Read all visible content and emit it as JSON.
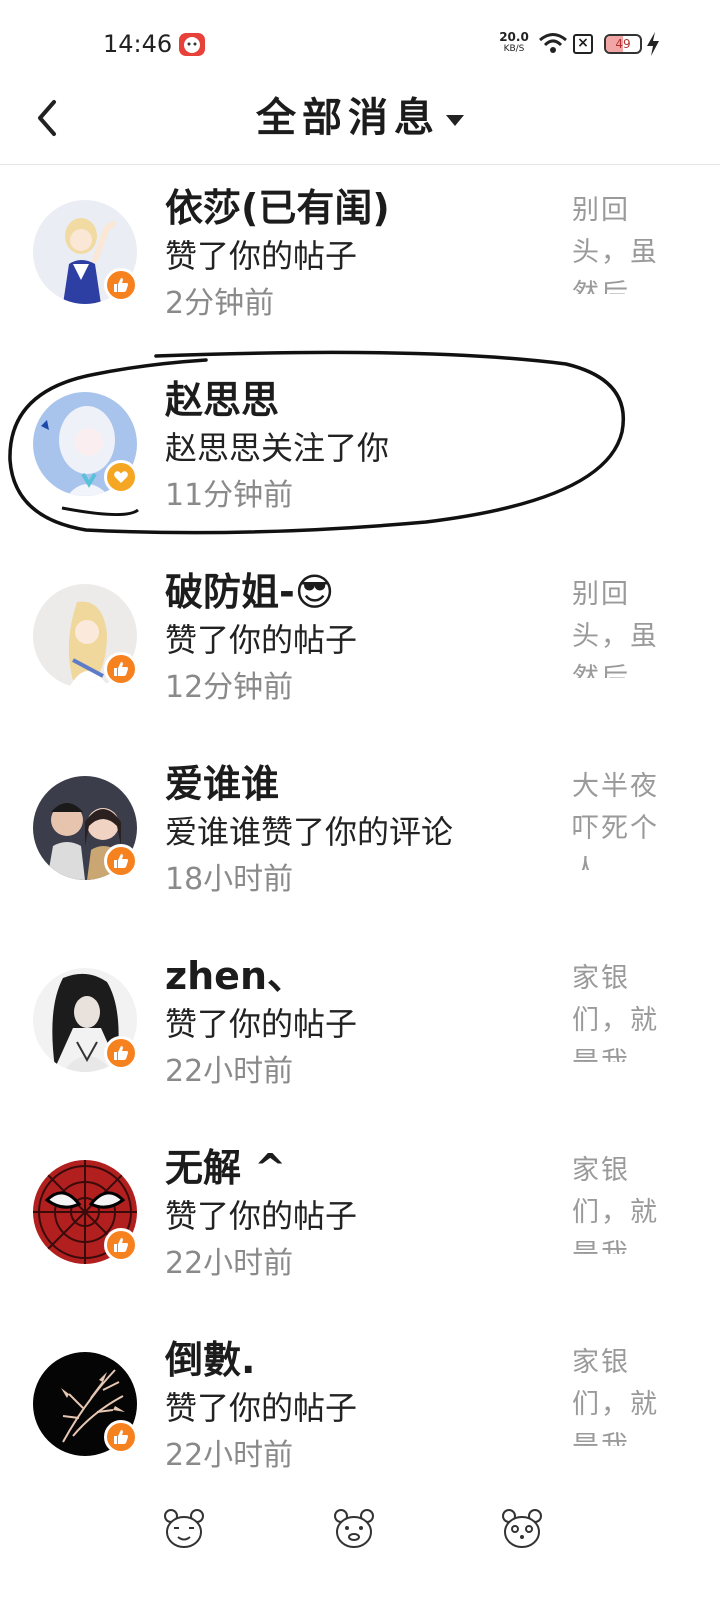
{
  "status_bar": {
    "time": "14:46",
    "net_speed": "20.0",
    "net_unit": "KB/S",
    "battery_level": "49",
    "battery_fraction": 0.49
  },
  "header": {
    "title": "全部消息"
  },
  "messages": [
    {
      "name": "依莎(已有闺)",
      "action": "赞了你的帖子",
      "time": "2分钟前",
      "preview": "别回头，虽然后",
      "badge": "thumbs-up-icon",
      "avatar": "anime-girl-waving"
    },
    {
      "name": "赵思思",
      "action": "赵思思关注了你",
      "time": "11分钟前",
      "preview": "",
      "badge": "heart-icon",
      "avatar": "anime-girl-white-hair"
    },
    {
      "name": "破防姐-😎",
      "action": "赞了你的帖子",
      "time": "12分钟前",
      "preview": "别回头，虽然后",
      "badge": "thumbs-up-icon",
      "avatar": "anime-girl-blonde"
    },
    {
      "name": "爱谁谁",
      "action": "爱谁谁赞了你的评论",
      "time": "18小时前",
      "preview": "大半夜吓死个人",
      "badge": "thumbs-up-icon",
      "avatar": "couple-photo"
    },
    {
      "name": "zhen、",
      "action": "赞了你的帖子",
      "time": "22小时前",
      "preview": "家银们，就是我",
      "badge": "thumbs-up-icon",
      "avatar": "ink-style-swordsman"
    },
    {
      "name": "无解 ^",
      "action": "赞了你的帖子",
      "time": "22小时前",
      "preview": "家银们，就是我",
      "badge": "thumbs-up-icon",
      "avatar": "spiderman-mask"
    },
    {
      "name": "倒數.",
      "action": "赞了你的帖子",
      "time": "22小时前",
      "preview": "家银们，就是我",
      "badge": "thumbs-up-icon",
      "avatar": "bamboo-on-black"
    }
  ],
  "bottom_nav": [
    "bear-face-icon",
    "bear-face-icon",
    "bear-face-icon"
  ],
  "colors": {
    "badge_orange": "#f5821f",
    "secondary_text": "#8a8a8a"
  }
}
